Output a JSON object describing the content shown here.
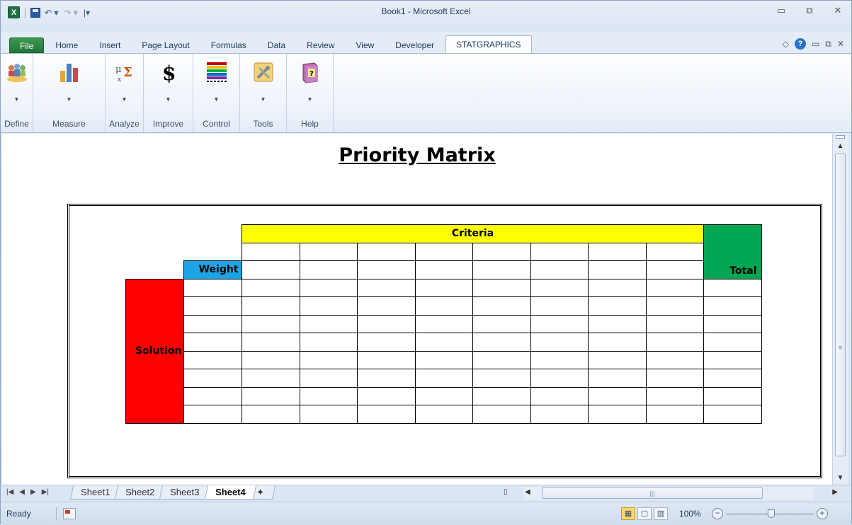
{
  "window": {
    "title": "Book1  -  Microsoft Excel",
    "app_icon": "X",
    "controls": {
      "minimize": "▭",
      "restore": "⧉",
      "close": "✕"
    }
  },
  "quick_access": {
    "undo": "↶ ▾",
    "redo": "↷ ▾",
    "customize": "|▾"
  },
  "ribbon": {
    "tabs": [
      "File",
      "Home",
      "Insert",
      "Page Layout",
      "Formulas",
      "Data",
      "Review",
      "View",
      "Developer",
      "STATGRAPHICS"
    ],
    "active_tab": "STATGRAPHICS",
    "help_controls": {
      "minimize_ribbon": "◇",
      "help": "?",
      "min": "▭",
      "restore": "⧉",
      "close": "✕"
    },
    "groups": [
      {
        "label": "Define",
        "icon": "people-icon"
      },
      {
        "label": "Measure",
        "icon": "bar-chart-icon"
      },
      {
        "label": "Analyze",
        "icon": "formula-icon"
      },
      {
        "label": "Improve",
        "icon": "dollar-icon"
      },
      {
        "label": "Control",
        "icon": "control-chart-icon"
      },
      {
        "label": "Tools",
        "icon": "tools-icon"
      },
      {
        "label": "Help",
        "icon": "help-book-icon"
      }
    ],
    "dropdown_arrow": "▼"
  },
  "sheet": {
    "title": "Priority Matrix",
    "matrix": {
      "criteria_label": "Criteria",
      "weight_label": "Weight",
      "total_label": "Total",
      "solution_label": "Solution",
      "criteria_columns": 8,
      "solution_rows": 8,
      "colors": {
        "criteria": "#ffff00",
        "weight": "#1ba5e6",
        "total": "#00a651",
        "solution": "#ff0000"
      }
    }
  },
  "sheet_tabs": {
    "nav": [
      "|◀",
      "◀",
      "▶",
      "▶|"
    ],
    "tabs": [
      "Sheet1",
      "Sheet2",
      "Sheet3",
      "Sheet4"
    ],
    "active": "Sheet4",
    "new_sheet": "✦"
  },
  "scroll": {
    "up": "▲",
    "down": "▼",
    "left": "◀",
    "right": "▶",
    "grip_v": "≡",
    "grip_h": "|||"
  },
  "status": {
    "ready": "Ready",
    "zoom": "100%",
    "zoom_minus": "−",
    "zoom_plus": "+",
    "views": [
      "▦",
      "▢",
      "▥"
    ]
  }
}
